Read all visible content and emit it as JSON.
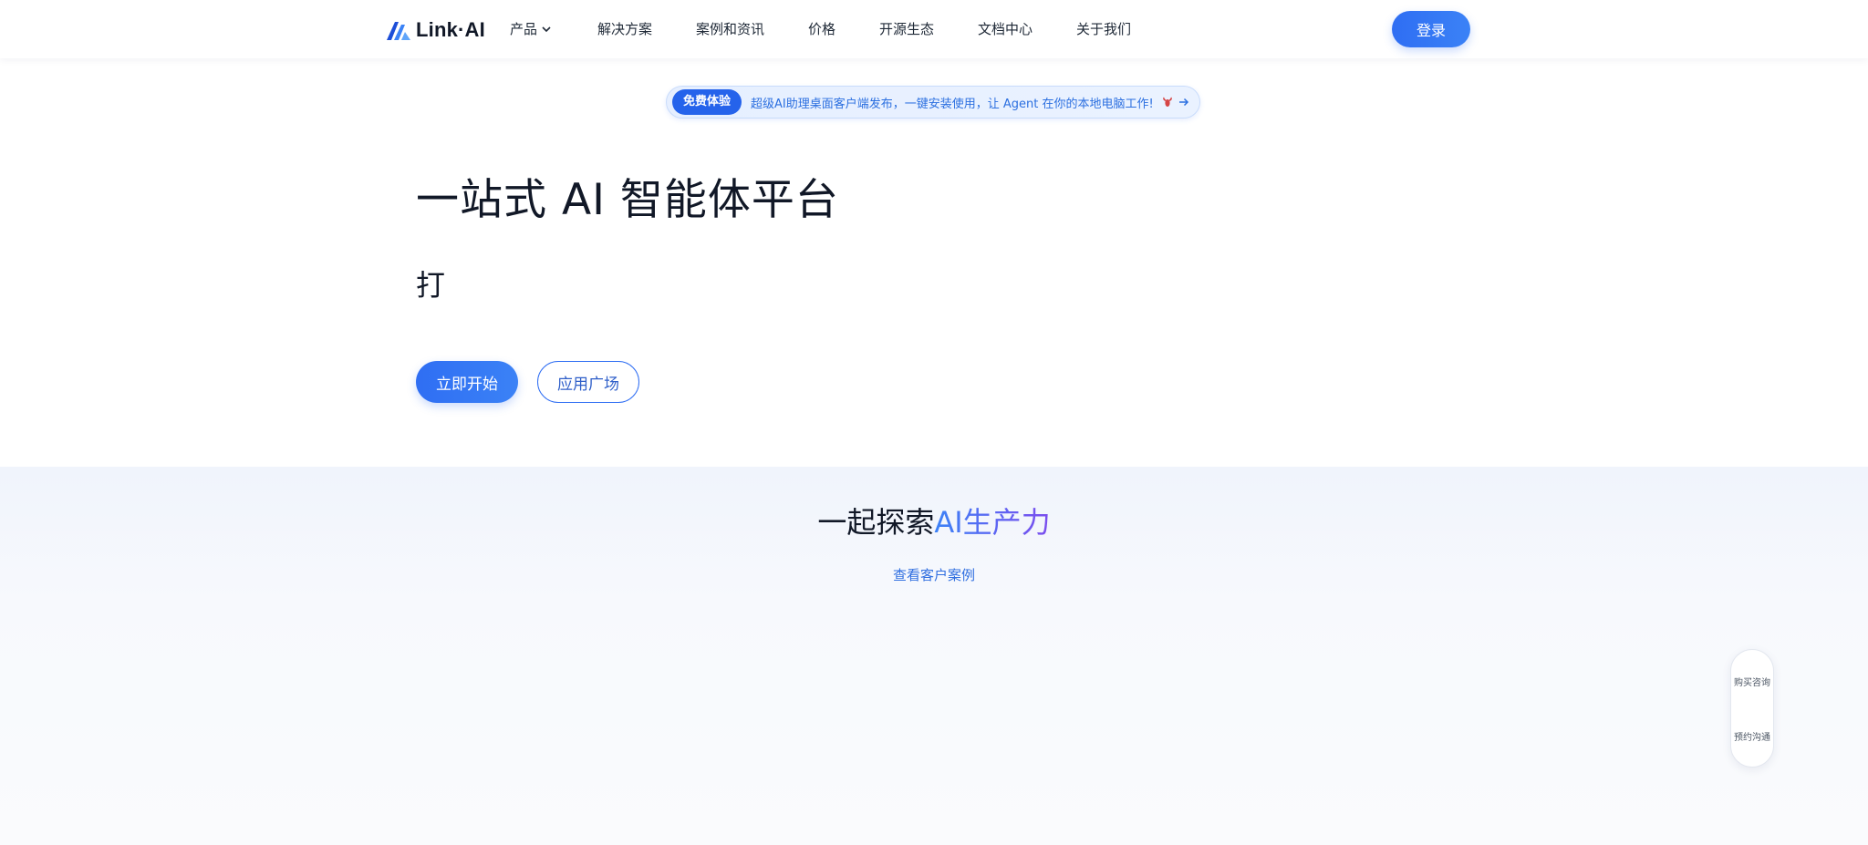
{
  "header": {
    "logo_text": "Link·AI",
    "logo_icon": "link-ai-logo-icon",
    "nav": [
      {
        "label": "产品",
        "has_dropdown": true
      },
      {
        "label": "解决方案"
      },
      {
        "label": "案例和资讯"
      },
      {
        "label": "价格"
      },
      {
        "label": "开源生态"
      },
      {
        "label": "文档中心"
      },
      {
        "label": "关于我们"
      }
    ],
    "login_label": "登录"
  },
  "announcement": {
    "badge": "免费体验",
    "text": "超级AI助理桌面客户端发布，一键安装使用，让 Agent 在你的本地电脑工作!",
    "icons": [
      "lobster-icon",
      "arrow-right-icon"
    ]
  },
  "hero": {
    "title": "一站式 AI 智能体平台",
    "typing_text": "打",
    "primary_button": "立即开始",
    "secondary_button": "应用广场"
  },
  "explore": {
    "title_plain": "一起探索",
    "title_highlight": "AI生产力",
    "link": "查看客户案例"
  },
  "float_widget": {
    "buy": "购买咨询",
    "book": "预约沟通"
  },
  "colors": {
    "brand_blue": "#2f6ef3",
    "gradient_end": "#7c4dee",
    "section_bg": "#f0f4fc"
  }
}
